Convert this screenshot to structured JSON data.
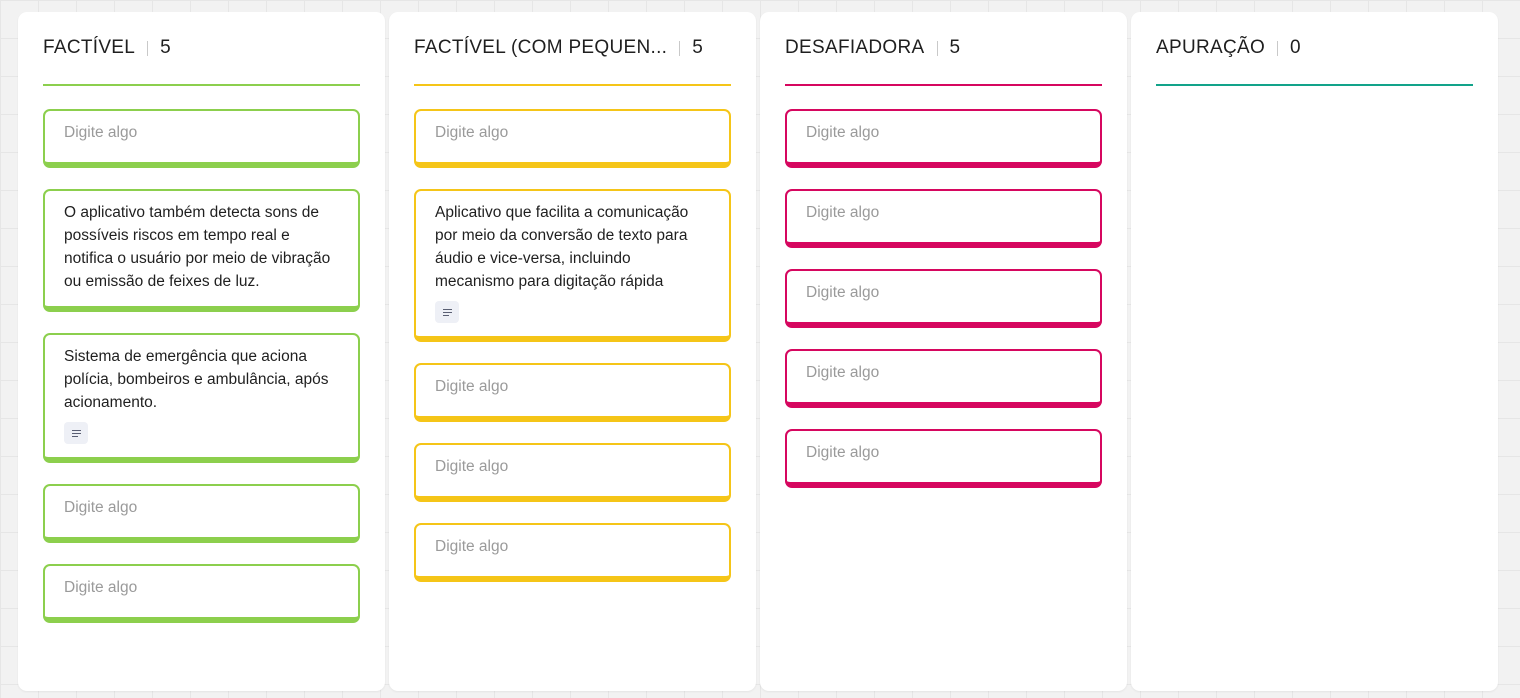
{
  "board": {
    "columns": [
      {
        "title": "FACTÍVEL",
        "count": "5",
        "accent": "#8ccf4d",
        "cards": [
          {
            "text": "Digite algo",
            "empty": true,
            "note": false
          },
          {
            "text": "O aplicativo também detecta sons de possíveis riscos em tempo real e notifica o usuário por meio de vibração ou emissão de feixes de luz.",
            "empty": false,
            "note": false
          },
          {
            "text": "Sistema de emergência que aciona polícia, bombeiros e ambulância, após acionamento.",
            "empty": false,
            "note": true
          },
          {
            "text": "Digite algo",
            "empty": true,
            "note": false
          },
          {
            "text": "Digite algo",
            "empty": true,
            "note": false
          }
        ]
      },
      {
        "title": "FACTÍVEL (COM PEQUEN...",
        "count": "5",
        "accent": "#f5c518",
        "cards": [
          {
            "text": "Digite algo",
            "empty": true,
            "note": false
          },
          {
            "text": "Aplicativo que facilita a comunicação por meio da conversão de texto para áudio e vice-versa, incluindo mecanismo para digitação rápida",
            "empty": false,
            "note": true
          },
          {
            "text": "Digite algo",
            "empty": true,
            "note": false
          },
          {
            "text": "Digite algo",
            "empty": true,
            "note": false
          },
          {
            "text": "Digite algo",
            "empty": true,
            "note": false
          }
        ]
      },
      {
        "title": "DESAFIADORA",
        "count": "5",
        "accent": "#d6075f",
        "cards": [
          {
            "text": "Digite algo",
            "empty": true,
            "note": false
          },
          {
            "text": "Digite algo",
            "empty": true,
            "note": false
          },
          {
            "text": "Digite algo",
            "empty": true,
            "note": false
          },
          {
            "text": "Digite algo",
            "empty": true,
            "note": false
          },
          {
            "text": "Digite algo",
            "empty": true,
            "note": false
          }
        ]
      },
      {
        "title": "APURAÇÃO",
        "count": "0",
        "accent": "#12a38a",
        "cards": []
      }
    ]
  },
  "icons": {
    "note": "note-lines-icon"
  }
}
